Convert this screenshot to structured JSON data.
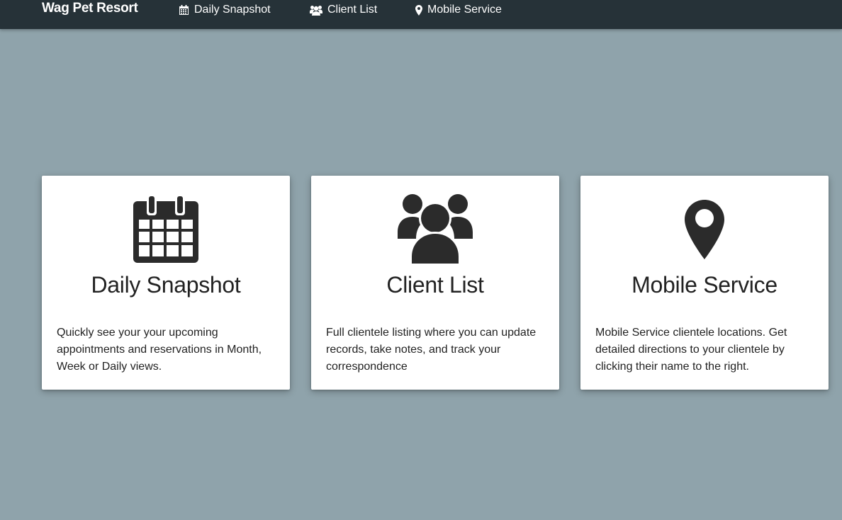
{
  "navbar": {
    "brand": "Wag Pet Resort",
    "links": [
      {
        "label": "Daily Snapshot",
        "icon": "calendar-icon"
      },
      {
        "label": "Client List",
        "icon": "users-icon"
      },
      {
        "label": "Mobile Service",
        "icon": "map-marker-icon"
      }
    ]
  },
  "cards": [
    {
      "title": "Daily Snapshot",
      "icon": "calendar-icon",
      "description": "Quickly see your your upcoming appointments and reservations in Month, Week or Daily views."
    },
    {
      "title": "Client List",
      "icon": "users-icon",
      "description": "Full clientele listing where you can update records, take notes, and track your correspondence"
    },
    {
      "title": "Mobile Service",
      "icon": "map-marker-icon",
      "description": "Mobile Service clientele locations. Get detailed directions to your clientele by clicking their name to the right."
    }
  ],
  "colors": {
    "navbar_bg": "#263238",
    "page_bg": "#8fa3ab",
    "card_bg": "#ffffff",
    "icon_color": "#2b2b2b"
  }
}
